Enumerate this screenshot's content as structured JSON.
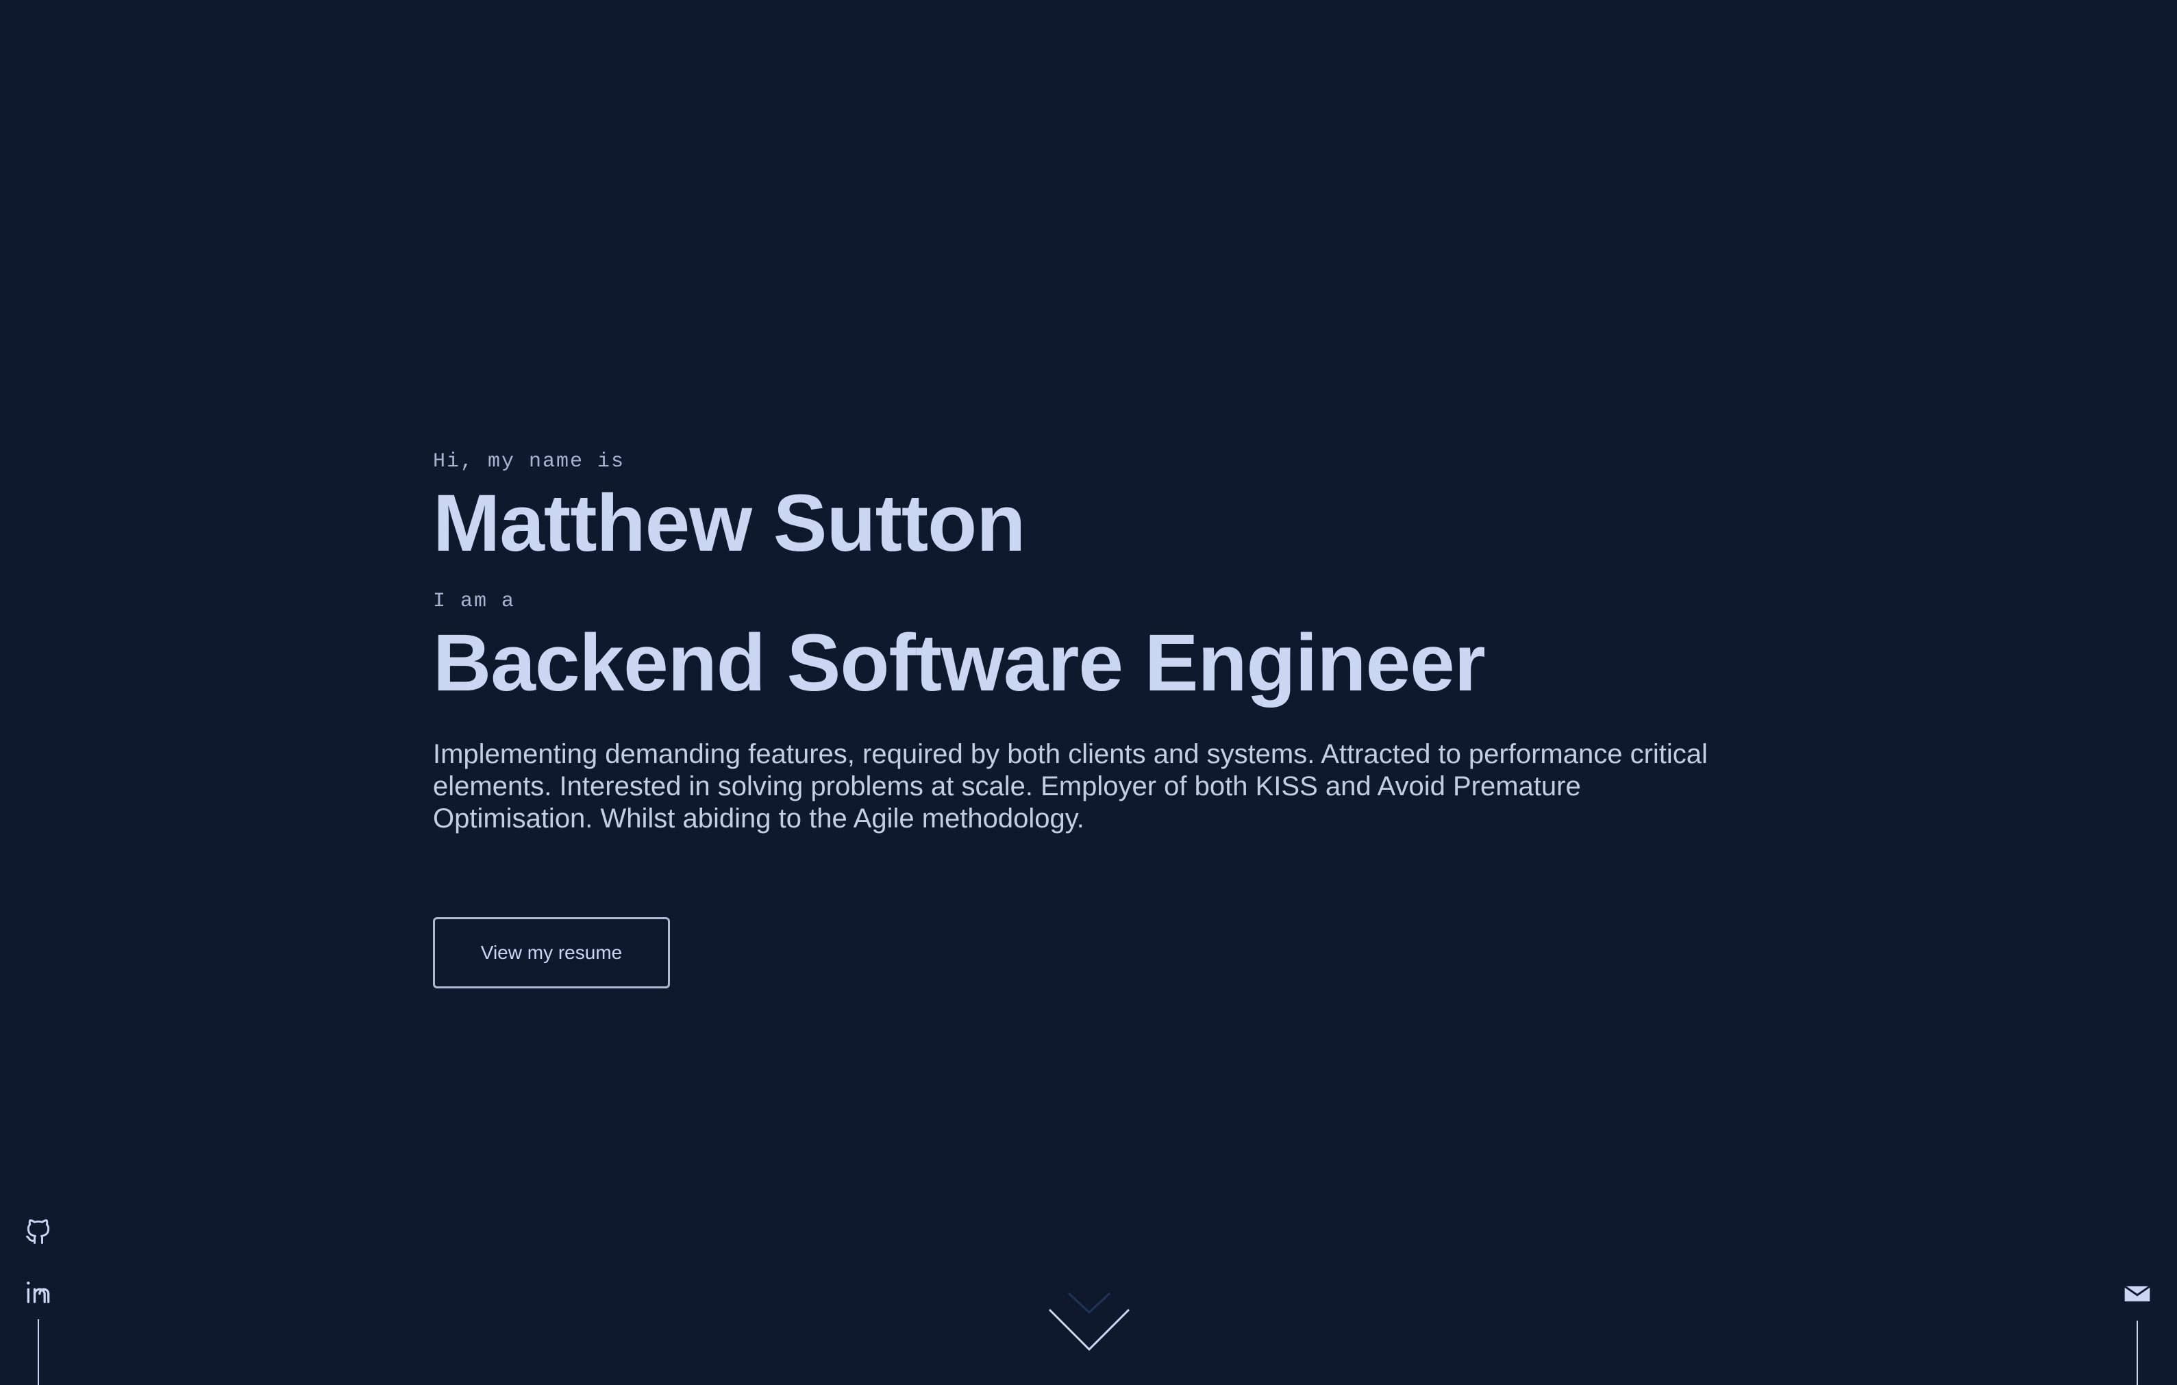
{
  "hero": {
    "greeting": "Hi, my name is",
    "name": "Matthew Sutton",
    "intro": "I am a",
    "role": "Backend Software Engineer",
    "summary": "Implementing demanding features, required by both clients and systems. Attracted to performance critical elements. Interested in solving problems at scale. Employer of both KISS and Avoid Premature Optimisation. Whilst abiding to the Agile methodology.",
    "resume_button": "View my resume"
  },
  "social": {
    "icons": [
      "github-icon",
      "linkedin-icon"
    ],
    "email_icon": "mail-icon"
  },
  "scroll": {
    "icon": "chevron-down-icon"
  },
  "colors": {
    "background": "#0e192e",
    "text": "#cbd6f3",
    "muted": "#a8b4cf"
  }
}
